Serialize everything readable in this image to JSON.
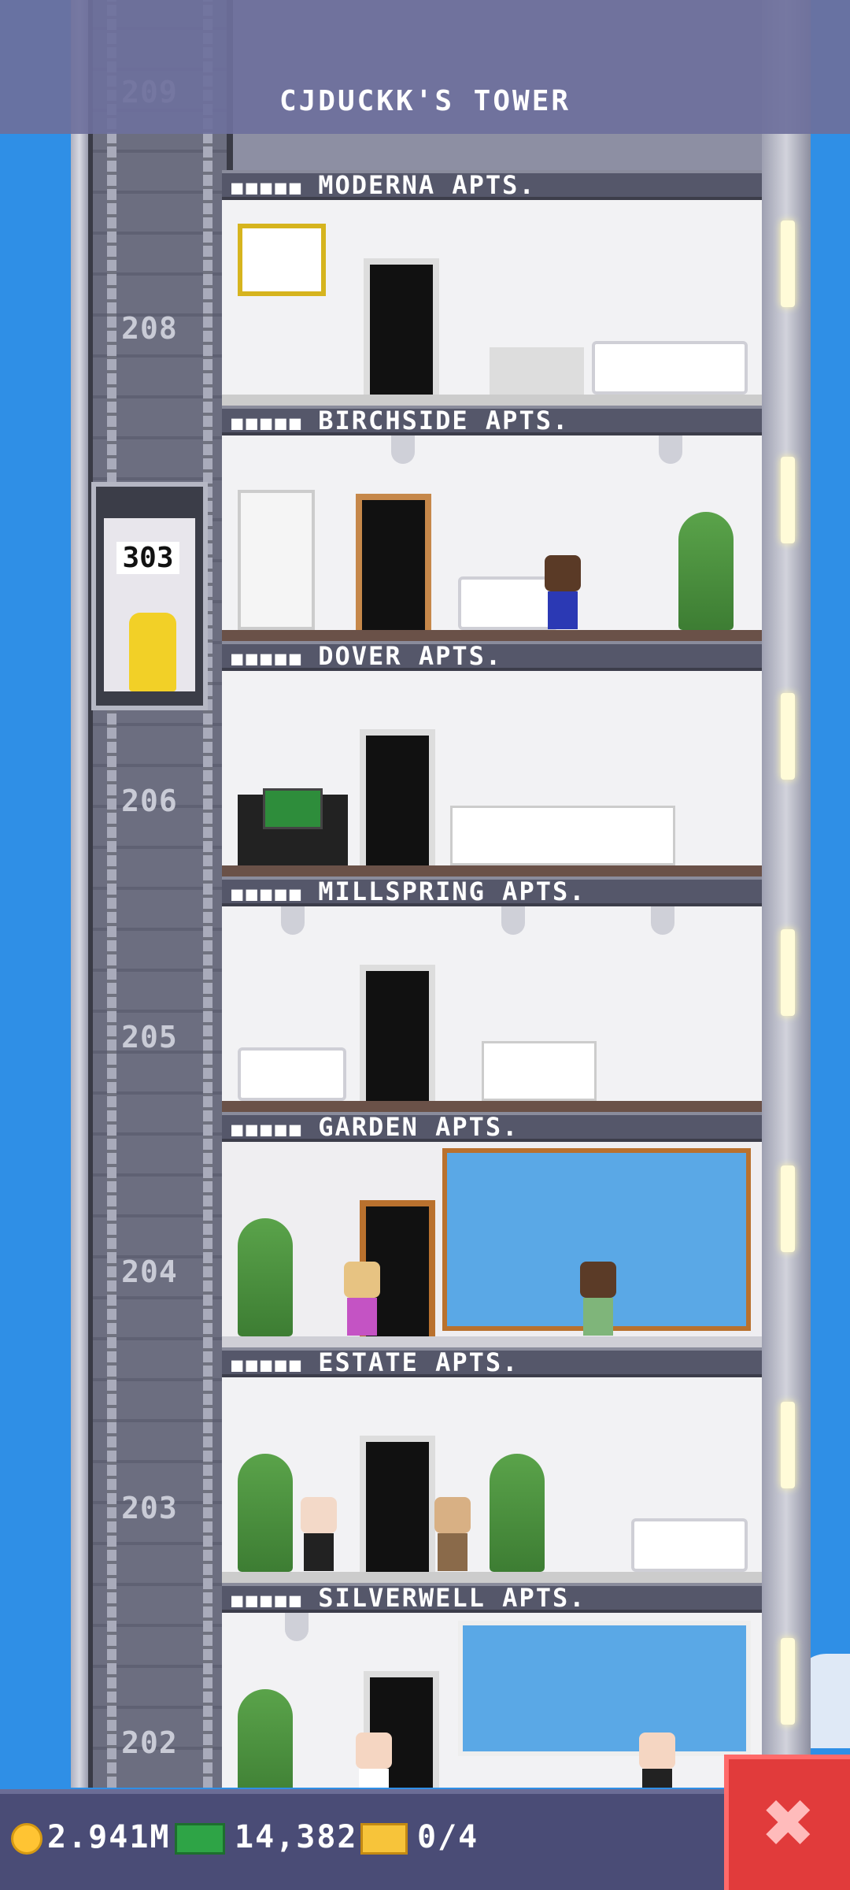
{
  "header": {
    "title": "CJDUCKK'S TOWER",
    "top_floor_number": "209"
  },
  "floors": [
    {
      "number": "208",
      "sign": "MODERNA APTS."
    },
    {
      "number": "",
      "sign": "BIRCHSIDE APTS."
    },
    {
      "number": "206",
      "sign": "DOVER APTS."
    },
    {
      "number": "205",
      "sign": "MILLSPRING APTS."
    },
    {
      "number": "204",
      "sign": "GARDEN APTS."
    },
    {
      "number": "203",
      "sign": "ESTATE APTS."
    },
    {
      "number": "202",
      "sign": "SILVERWELL APTS."
    }
  ],
  "resident_icons": "■■■■■",
  "elevator": {
    "destination": "303"
  },
  "status_bar": {
    "coins": "2.941M",
    "bux": "14,382",
    "tickets": "0/4"
  },
  "close_button": {
    "label": "✖"
  },
  "colors": {
    "sky": "#2f8fe6",
    "bar": "#4a4c76",
    "close": "#e13b3b"
  }
}
